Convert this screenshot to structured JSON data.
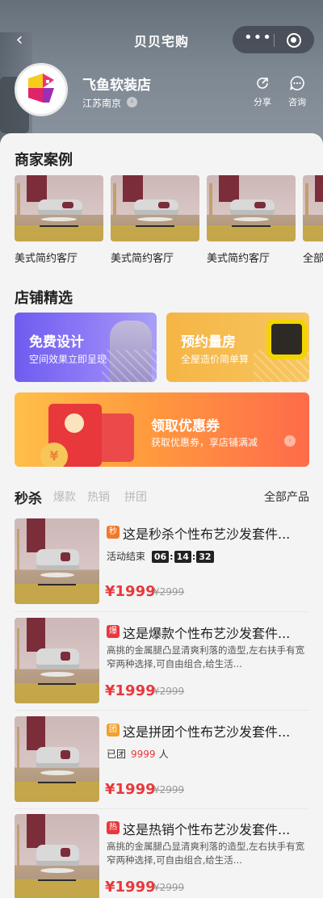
{
  "titlebar": {
    "title": "贝贝宅购",
    "more_glyph": "•••"
  },
  "store": {
    "name": "飞鱼软装店",
    "location": "江苏南京",
    "share_label": "分享",
    "consult_label": "咨询"
  },
  "cases": {
    "title": "商家案例",
    "items": [
      {
        "caption": "美式简约客厅"
      },
      {
        "caption": "美式简约客厅"
      },
      {
        "caption": "美式简约客厅"
      },
      {
        "caption": "全部"
      }
    ]
  },
  "featured": {
    "title": "店铺精选",
    "free_design": {
      "title": "免费设计",
      "subtitle": "空间效果立即呈现"
    },
    "measure": {
      "title": "预约量房",
      "subtitle": "全屋造价简单算"
    },
    "coupon": {
      "title": "领取优惠券",
      "subtitle": "获取优惠券，享店铺满减",
      "coin_symbol": "¥"
    }
  },
  "tabs": {
    "items": [
      "秒杀",
      "爆款",
      "热销",
      "拼团"
    ],
    "all_products": "全部产品"
  },
  "products": [
    {
      "badge": "秒",
      "badge_color": "#f07a2b",
      "title": "这是秒杀个性布艺沙发套件...",
      "status": "活动结束",
      "countdown": [
        "06",
        "14",
        "32"
      ],
      "price": "¥1999",
      "old_price": "¥2999"
    },
    {
      "badge": "爆",
      "badge_color": "#e8383c",
      "title": "这是爆款个性布艺沙发套件...",
      "desc": "高挑的金属腿凸显清爽利落的造型,左右扶手有宽窄两种选择,可自由组合,给生活...",
      "price": "¥1999",
      "old_price": "¥2999"
    },
    {
      "badge": "团",
      "badge_color": "#f0a02b",
      "title": "这是拼团个性布艺沙发套件...",
      "group_prefix": "已团",
      "group_count": "9999",
      "group_suffix": "人",
      "price": "¥1999",
      "old_price": "¥2999"
    },
    {
      "badge": "热",
      "badge_color": "#e8383c",
      "title": "这是热销个性布艺沙发套件...",
      "desc": "高挑的金属腿凸显清爽利落的造型,左右扶手有宽窄两种选择,可自由组合,给生活...",
      "price": "¥1999",
      "old_price": "¥2999"
    }
  ],
  "colors": {
    "accent_red": "#e8383c",
    "purple": "#7b66f2",
    "orange": "#f5b545"
  }
}
